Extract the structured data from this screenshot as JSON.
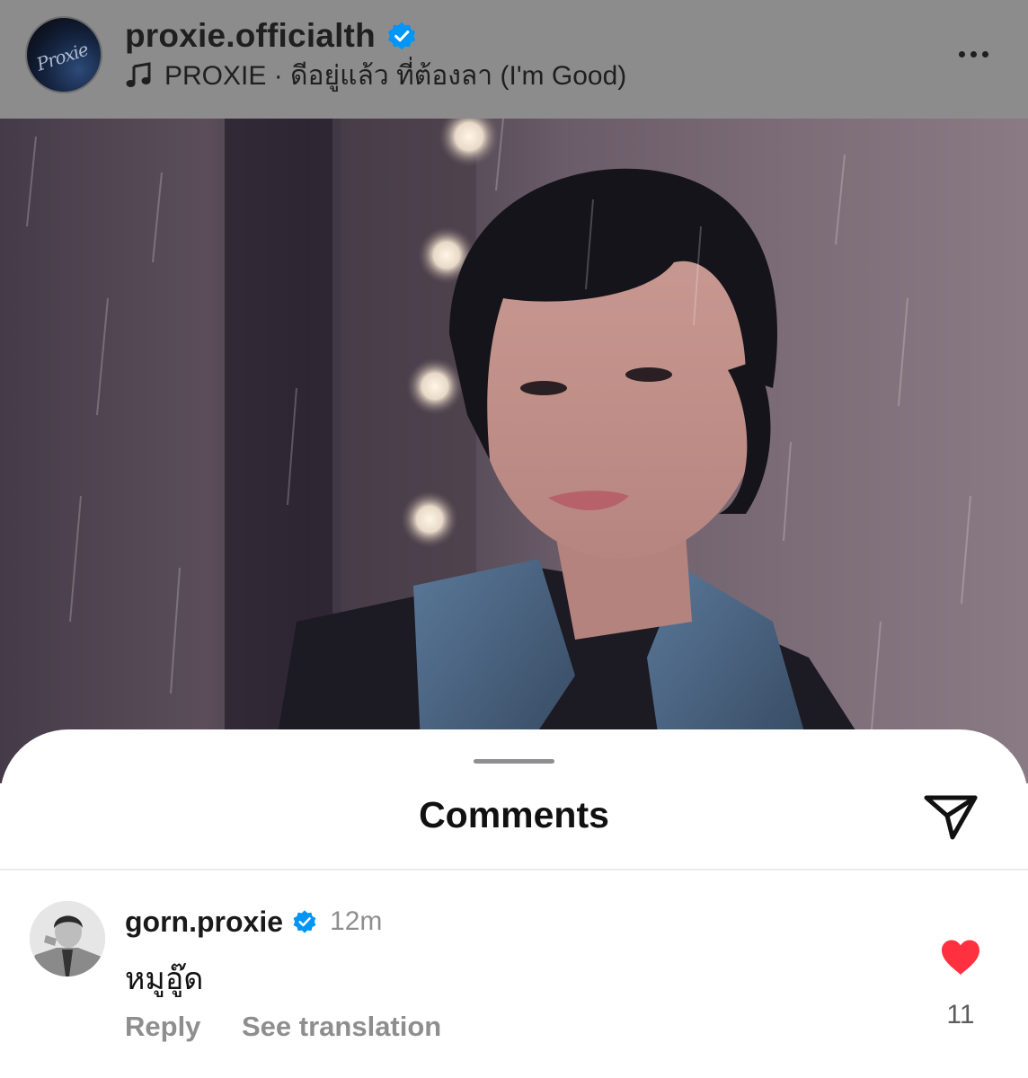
{
  "post": {
    "username": "proxie.officialth",
    "avatar_logo_text": "Proxie",
    "verified": true,
    "music": "PROXIE · ดีอยู่แล้ว ที่ต้องลา (I'm Good)",
    "icons": {
      "music": "music-note-icon",
      "verified": "verified-badge-icon",
      "more": "more-horizontal-icon"
    },
    "image": "portrait photo of a man with dark hair, spiked denim jacket, rain effect, vanity mirror lights"
  },
  "comments_sheet": {
    "title": "Comments",
    "share_icon": "send-icon",
    "comments": [
      {
        "username": "gorn.proxie",
        "verified": true,
        "time": "12m",
        "text": "หมูอู๊ด",
        "reply_label": "Reply",
        "translate_label": "See translation",
        "likes": "11",
        "liked": true
      }
    ]
  },
  "colors": {
    "verified_blue": "#0095f6",
    "like_red": "#ff3040",
    "header_dim": "#8c8c8c",
    "secondary_text": "#8e8e8e"
  }
}
